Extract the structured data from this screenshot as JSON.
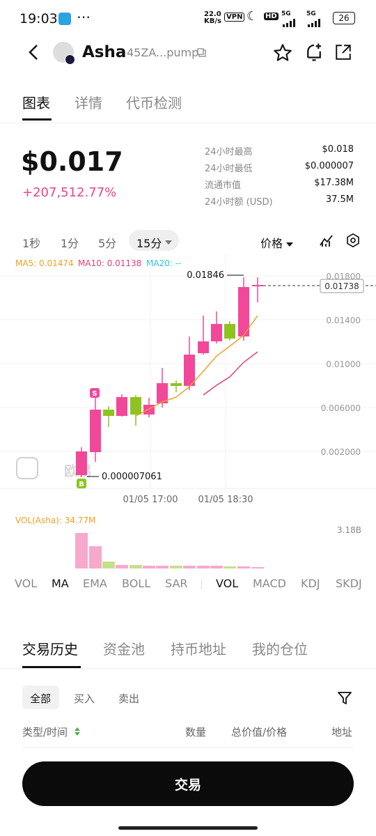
{
  "status_bar": {
    "time": "19:03",
    "net_speed_value": "22.0",
    "net_speed_unit": "KB/s",
    "vpn": "VPN",
    "hd_badge": "HD",
    "sig1": "5G",
    "sig2": "5G",
    "battery": "26"
  },
  "header": {
    "token_name": "Asha",
    "token_address": "45ZA...pump"
  },
  "top_tabs": [
    "图表",
    "详情",
    "代币检测"
  ],
  "price": {
    "value": "$0.017",
    "change": "+207,512.77%"
  },
  "stats": [
    {
      "label": "24小时最高",
      "value": "$0.018"
    },
    {
      "label": "24小时最低",
      "value": "$0.000007"
    },
    {
      "label": "流通市值",
      "value": "$17.38M"
    },
    {
      "label": "24小时额 (USD)",
      "value": "37.5M"
    }
  ],
  "timeframes": [
    "1秒",
    "1分",
    "5分",
    "15分"
  ],
  "price_toggle": "价格",
  "ma_legend": {
    "ma5": "MA5: 0.01474",
    "ma10": "MA10: 0.01138",
    "ma20": "MA20: --"
  },
  "colors": {
    "up": "#f2489a",
    "down": "#8fc31f",
    "ma5": "#f0a020",
    "ma10": "#e0407a",
    "ma20": "#26c6da"
  },
  "chart_data": {
    "type": "candlestick",
    "y_ticks": [
      "0.01800",
      "0.01400",
      "0.01000",
      "0.006000",
      "0.002000"
    ],
    "x_ticks": [
      "01/05 17:00",
      "01/05 18:30"
    ],
    "current_price_label": "0.01738",
    "high_label": "0.01846",
    "low_label": "0.000007061",
    "markers": [
      "S",
      "B"
    ],
    "watermark": "欧易",
    "ylim": [
      0,
      0.0185
    ]
  },
  "volume": {
    "label": "VOL(Asha): 34.77M",
    "axis_label": "3.18B"
  },
  "indicators": [
    "VOL",
    "MA",
    "EMA",
    "BOLL",
    "SAR",
    "VOL",
    "MACD",
    "KDJ",
    "SKDJ"
  ],
  "history_tabs": [
    "交易历史",
    "资金池",
    "持币地址",
    "我的仓位"
  ],
  "filters": [
    "全部",
    "买入",
    "卖出"
  ],
  "table_headers": [
    "类型/时间",
    "数量",
    "总价值/价格",
    "地址"
  ],
  "trade_button": "交易"
}
